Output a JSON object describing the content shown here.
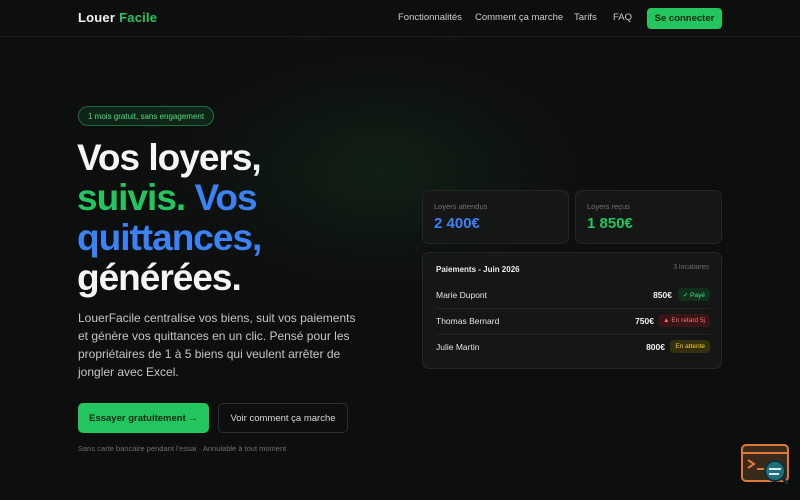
{
  "nav": {
    "logo_part1": "Louer",
    "logo_part2": "Facile",
    "links": [
      "Fonctionnalités",
      "Comment ça marche",
      "Tarifs",
      "FAQ"
    ],
    "cta": "Se connecter"
  },
  "hero": {
    "badge": "1 mois gratuit, sans engagement",
    "title_line1": "Vos loyers,",
    "title_line2_green": "suivis.",
    "title_line2_blue": "Vos",
    "title_line3": "quittances,",
    "title_line4": "générées.",
    "lead": "LouerFacile centralise vos biens, suit vos paiements et génère vos quittances en un clic. Pensé pour les propriétaires de 1 à 5 biens qui veulent arrêter de jongler avec Excel.",
    "primary_cta": "Essayer gratuitement →",
    "secondary_cta": "Voir comment ça marche",
    "fine_print": "Sans carte bancaire pendant l'essai · Annulable à tout moment"
  },
  "stats": [
    {
      "label": "Loyers attendus",
      "value": "2 400€"
    },
    {
      "label": "Loyers reçus",
      "value": "1 850€"
    }
  ],
  "payments": {
    "title": "Paiements - Juin 2026",
    "count": "3 locataires",
    "rows": [
      {
        "name": "Marie Dupont",
        "amount": "850€",
        "status": "✓ Payé"
      },
      {
        "name": "Thomas Bernard",
        "amount": "750€",
        "status": "▲ En retard 5j"
      },
      {
        "name": "Julie Martin",
        "amount": "800€",
        "status": "En attente"
      }
    ]
  },
  "colors": {
    "accent_green": "#22c55e",
    "accent_blue": "#3b82f6",
    "background": "#0d0f0e",
    "late_red": "#f87171",
    "pending_yellow": "#facc15"
  },
  "icons": {
    "corner_widget": "terminal-search-icon"
  }
}
